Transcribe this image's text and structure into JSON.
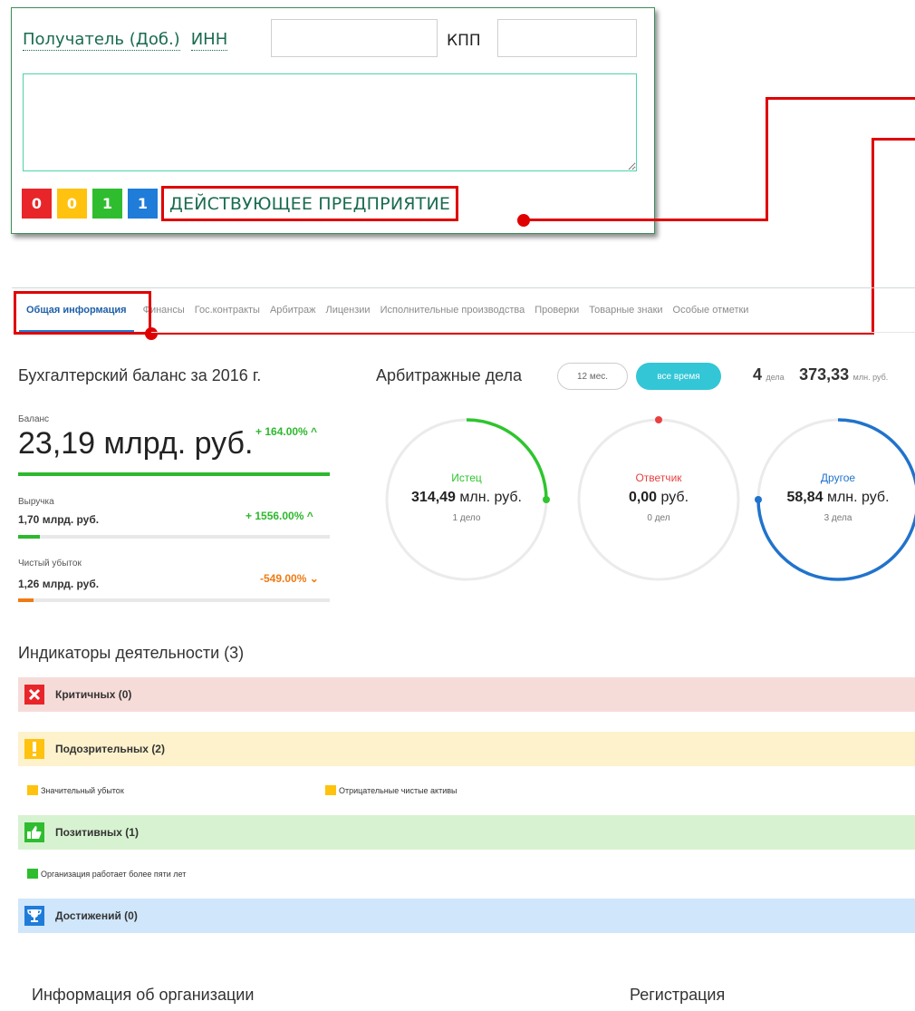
{
  "popup": {
    "recipient_label": "Получатель (Доб.)",
    "inn_label": "ИНН",
    "inn_value": "",
    "kpp_label": "КПП",
    "kpp_value": "",
    "textarea_value": "",
    "counters": [
      {
        "value": "0",
        "color": "#e8262a"
      },
      {
        "value": "0",
        "color": "#ffc20e"
      },
      {
        "value": "1",
        "color": "#2fbd2f"
      },
      {
        "value": "1",
        "color": "#1f7cd9"
      }
    ],
    "status": "ДЕЙСТВУЮЩЕЕ ПРЕДПРИЯТИЕ"
  },
  "tabs": [
    "Общая информация",
    "Финансы",
    "Гос.контракты",
    "Арбитраж",
    "Лицензии",
    "Исполнительные производства",
    "Проверки",
    "Товарные знаки",
    "Особые отметки"
  ],
  "balance": {
    "title": "Бухгалтерский баланс за 2016 г.",
    "balance_label": "Баланс",
    "balance_value": "23,19 млрд. руб.",
    "balance_change": "+ 164.00% ^",
    "revenue_label": "Выручка",
    "revenue_value": "1,70 млрд. руб.",
    "revenue_change": "+ 1556.00% ^",
    "revenue_fill": 0.07,
    "loss_label": "Чистый убыток",
    "loss_value": "1,26 млрд. руб.",
    "loss_change": "-549.00% ⌄",
    "loss_fill": 0.05,
    "colors": {
      "green": "#2db82d",
      "orange": "#f07a12"
    }
  },
  "arbitrage": {
    "title": "Арбитражные дела",
    "btn_12m": "12 мес.",
    "btn_all": "все время",
    "cases_count": "4",
    "cases_unit": "дела",
    "total_value": "373,33",
    "total_unit": "млн. руб.",
    "circles": [
      {
        "title": "Истец",
        "num": "314,49",
        "unit": "млн. руб.",
        "sub": "1 дело",
        "color": "#2ec52e",
        "fraction": 0.25
      },
      {
        "title": "Ответчик",
        "num": "0,00",
        "unit": "руб.",
        "sub": "0 дел",
        "color": "#e84040",
        "fraction": 0.0
      },
      {
        "title": "Другое",
        "num": "58,84",
        "unit": "млн. руб.",
        "sub": "3 дела",
        "color": "#2173cc",
        "fraction": 0.75
      }
    ]
  },
  "indicators": {
    "title": "Индикаторы деятельности (3)",
    "critical": {
      "label": "Критичных (0)",
      "icon": "x-icon",
      "bg": "#f6dcd9",
      "icon_color": "#e8262a"
    },
    "suspicious": {
      "label": "Подозрительных (2)",
      "icon": "exclamation-icon",
      "bg": "#fdf2cc",
      "icon_color": "#ffc20e",
      "items": [
        "Значительный убыток",
        "Отрицательные чистые активы"
      ]
    },
    "positive": {
      "label": "Позитивных (1)",
      "icon": "thumbs-up-icon",
      "bg": "#d7f2d0",
      "icon_color": "#2fbd2f",
      "items": [
        "Организация работает более пяти лет"
      ]
    },
    "achievements": {
      "label": "Достижений (0)",
      "icon": "trophy-icon",
      "bg": "#cfe6fb",
      "icon_color": "#1f7cd9"
    }
  },
  "footer": {
    "org_info": "Информация об организации",
    "registration": "Регистрация"
  }
}
